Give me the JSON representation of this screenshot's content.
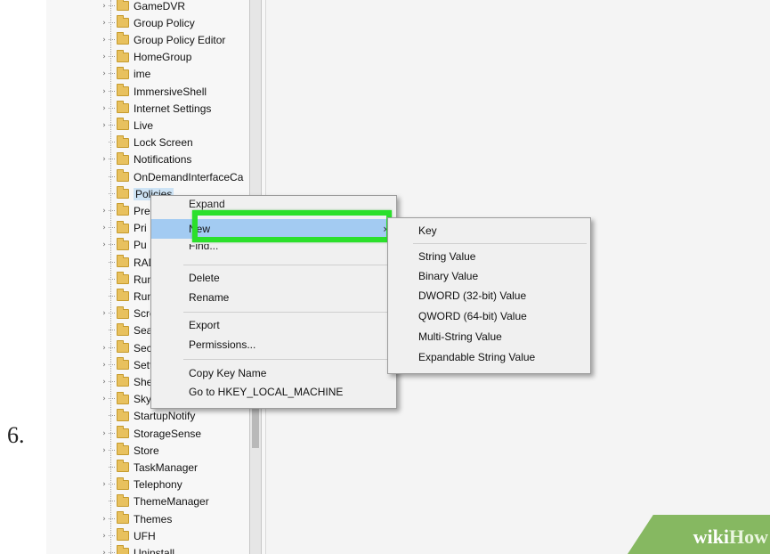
{
  "step_number": "6.",
  "tree": {
    "items": [
      {
        "label": "GameDVR",
        "expander": "›"
      },
      {
        "label": "Group Policy",
        "expander": "›"
      },
      {
        "label": "Group Policy Editor",
        "expander": "›"
      },
      {
        "label": "HomeGroup",
        "expander": "›"
      },
      {
        "label": "ime",
        "expander": "›"
      },
      {
        "label": "ImmersiveShell",
        "expander": "›"
      },
      {
        "label": "Internet Settings",
        "expander": "›"
      },
      {
        "label": "Live",
        "expander": "›"
      },
      {
        "label": "Lock Screen",
        "expander": ""
      },
      {
        "label": "Notifications",
        "expander": "›"
      },
      {
        "label": "OnDemandInterfaceCa",
        "expander": ""
      },
      {
        "label": "Policies",
        "expander": "",
        "selected": true
      },
      {
        "label": "Pre",
        "expander": "›"
      },
      {
        "label": "Pri",
        "expander": "›"
      },
      {
        "label": "Pu",
        "expander": "›"
      },
      {
        "label": "RAD",
        "expander": ""
      },
      {
        "label": "Run",
        "expander": ""
      },
      {
        "label": "Run(",
        "expander": ""
      },
      {
        "label": "Scre",
        "expander": "›"
      },
      {
        "label": "Sear",
        "expander": ""
      },
      {
        "label": "Secu",
        "expander": "›"
      },
      {
        "label": "Setti",
        "expander": "›"
      },
      {
        "label": "Shell",
        "expander": "›"
      },
      {
        "label": "Skyd",
        "expander": "›"
      },
      {
        "label": "StartupNotify",
        "expander": ""
      },
      {
        "label": "StorageSense",
        "expander": "›"
      },
      {
        "label": "Store",
        "expander": "›"
      },
      {
        "label": "TaskManager",
        "expander": ""
      },
      {
        "label": "Telephony",
        "expander": "›"
      },
      {
        "label": "ThemeManager",
        "expander": ""
      },
      {
        "label": "Themes",
        "expander": "›"
      },
      {
        "label": "UFH",
        "expander": "›"
      },
      {
        "label": "Uninstall",
        "expander": "›"
      }
    ]
  },
  "context_menu": {
    "expand": "Expand",
    "new": "New",
    "new_arrow": "›",
    "find": "Find...",
    "delete": "Delete",
    "rename": "Rename",
    "export": "Export",
    "permissions": "Permissions...",
    "copy_key_name": "Copy Key Name",
    "goto_hklm": "Go to HKEY_LOCAL_MACHINE"
  },
  "submenu": {
    "key": "Key",
    "string_value": "String Value",
    "binary_value": "Binary Value",
    "dword_value": "DWORD (32-bit) Value",
    "qword_value": "QWORD (64-bit) Value",
    "multi_string_value": "Multi-String Value",
    "expandable_string_value": "Expandable String Value"
  },
  "watermark": {
    "wiki": "wiki",
    "how": "How"
  },
  "colors": {
    "highlight_border": "#2be02b",
    "menu_hover": "#a3cbf2",
    "folder": "#e8c15e"
  }
}
